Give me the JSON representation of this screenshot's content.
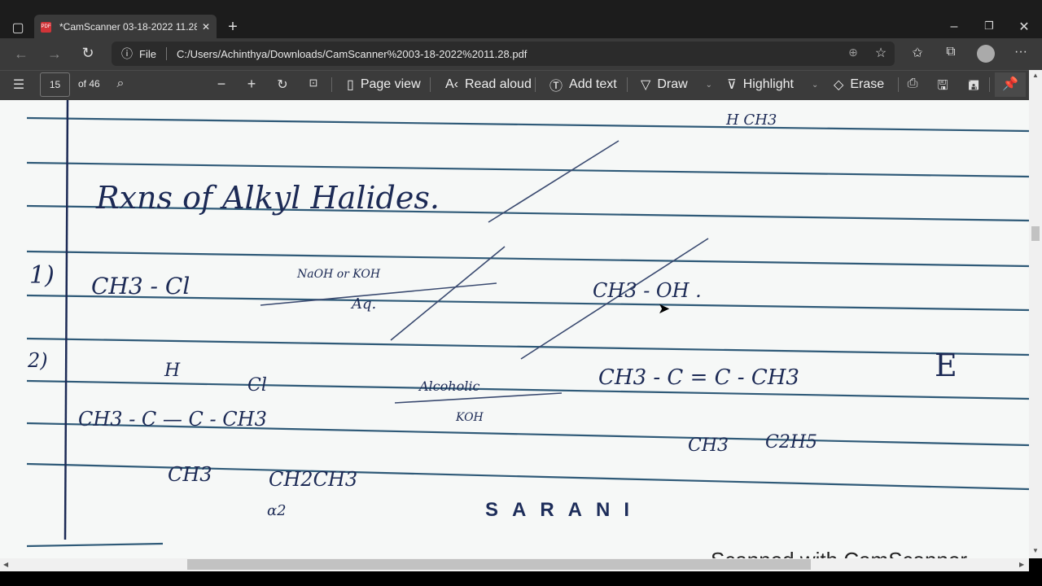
{
  "browser": {
    "tab_title": "*CamScanner 03-18-2022 11.28.",
    "address_prefix": "File",
    "url": "C:/Users/Achinthya/Downloads/CamScanner%2003-18-2022%2011.28.pdf"
  },
  "toolbar": {
    "page_number": "15",
    "page_total": "of 46",
    "page_view": "Page view",
    "read_aloud": "Read aloud",
    "add_text": "Add text",
    "draw": "Draw",
    "highlight": "Highlight",
    "erase": "Erase"
  },
  "document": {
    "heading": "Rxns of Alkyl Halides.",
    "item1_num": "1)",
    "item1_reactant": "CH3 - Cl",
    "item1_reagent_top": "NaOH or KOH",
    "item1_reagent_bottom": "Aq.",
    "item1_product": "CH3 - OH .",
    "item2_num": "2)",
    "item2_reactant_h": "H",
    "item2_reactant_main": "CH3 - C  —  C - CH3",
    "item2_cl": "Cl",
    "item2_ch3": "CH3",
    "item2_ch2ch3": "CH2CH3",
    "item2_a2": "α2",
    "item2_reagent_top": "Alcoholic",
    "item2_reagent_bottom": "KOH",
    "item2_product": "CH3 - C = C - CH3",
    "item2_product_sub1": "CH3",
    "item2_product_sub2": "C2H5",
    "mark_e": "E",
    "top_fragment": "H     CH3",
    "watermark": "SARANI",
    "footer": "Scanned with CamScanner"
  }
}
